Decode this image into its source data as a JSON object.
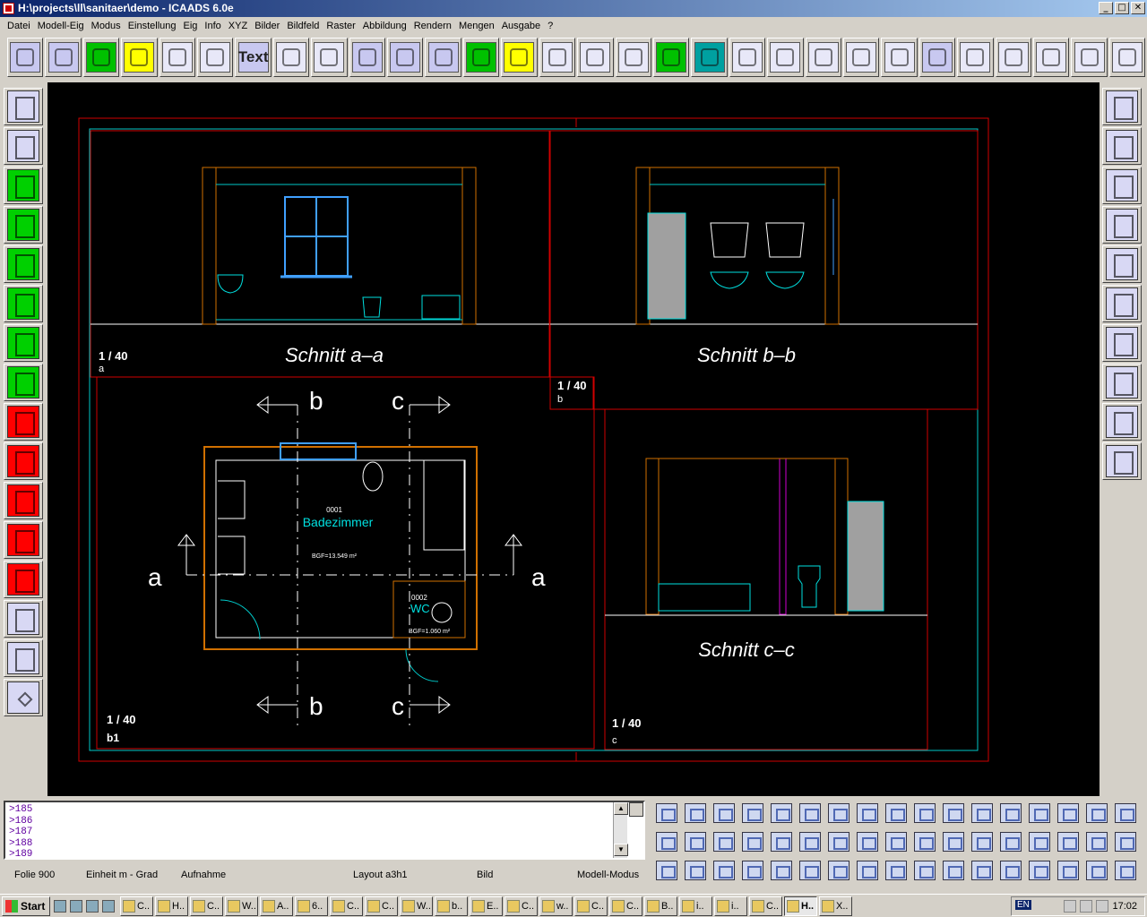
{
  "window": {
    "title": "H:\\projects\\ll\\sanitaer\\demo - ICAADS 6.0e",
    "controls": {
      "minimize": "_",
      "maximize": "□",
      "close": "✕"
    }
  },
  "menu": [
    "Datei",
    "Modell-Eig",
    "Modus",
    "Einstellung",
    "Eig",
    "Info",
    "XYZ",
    "Bilder",
    "Bildfeld",
    "Raster",
    "Abbildung",
    "Rendern",
    "Mengen",
    "Ausgabe",
    "?"
  ],
  "toolbar_top": [
    {
      "icon": "grid-points-icon",
      "style": "p"
    },
    {
      "icon": "polyline-icon",
      "style": "p"
    },
    {
      "icon": "circle-icon",
      "style": "g"
    },
    {
      "icon": "stairs-icon",
      "style": "y"
    },
    {
      "icon": "curve-icon",
      "style": "w"
    },
    {
      "icon": "mesh-icon",
      "style": "w"
    },
    {
      "icon": "text-icon",
      "style": "txt",
      "label": "Text"
    },
    {
      "icon": "dimension-icon",
      "style": "w"
    },
    {
      "icon": "hatch-icon",
      "style": "w"
    },
    {
      "icon": "symbol-library-icon",
      "style": "p"
    },
    {
      "icon": "box-3d-icon",
      "style": "p"
    },
    {
      "icon": "roof-icon",
      "style": "p"
    },
    {
      "icon": "stair-3d-icon",
      "style": "g"
    },
    {
      "icon": "pen-icon",
      "style": "y"
    },
    {
      "icon": "view-2d-icon",
      "style": "w"
    },
    {
      "icon": "frog-view-icon",
      "style": "w"
    },
    {
      "icon": "view-3d-icon",
      "style": "w"
    },
    {
      "icon": "drain-icon",
      "style": "g"
    },
    {
      "icon": "pipe-icon",
      "style": "t"
    },
    {
      "icon": "valve-symbol-icon",
      "style": "w"
    },
    {
      "icon": "gate-valve-icon",
      "style": "w"
    },
    {
      "icon": "closed-valve-icon",
      "style": "w"
    },
    {
      "icon": "pressure-gauge-icon",
      "style": "w"
    },
    {
      "icon": "elbow-icon",
      "style": "w"
    },
    {
      "icon": "wall-outlet-icon",
      "style": "p"
    },
    {
      "icon": "schematic-2d-icon",
      "style": "w"
    },
    {
      "icon": "radiator-icon",
      "style": "w"
    },
    {
      "icon": "pipe-route-icon",
      "style": "w"
    },
    {
      "icon": "duct-icon",
      "style": "w"
    },
    {
      "icon": "arrow-right-icon",
      "style": "w"
    }
  ],
  "toolbar_left": [
    {
      "icon": "draw-pencil-icon",
      "style": "p"
    },
    {
      "icon": "edit-pencil-icon",
      "style": "p"
    },
    {
      "icon": "tww-drain-icon",
      "style": "g"
    },
    {
      "icon": "drain-valve-icon",
      "style": "g"
    },
    {
      "icon": "riser-valve-icon",
      "style": "g"
    },
    {
      "icon": "triple-riser-icon",
      "style": "g"
    },
    {
      "icon": "pipe-connection-icon",
      "style": "g"
    },
    {
      "icon": "meter-icon",
      "style": "g"
    },
    {
      "icon": "tww-heater-icon",
      "style": "r"
    },
    {
      "icon": "heater-connection-icon",
      "style": "r"
    },
    {
      "icon": "heater-link-icon",
      "style": "r"
    },
    {
      "icon": "heater-riser-icon",
      "style": "r"
    },
    {
      "icon": "heater-pipe-icon",
      "style": "r"
    },
    {
      "icon": "schematic-link-icon",
      "style": "p"
    },
    {
      "icon": "schematic-node-icon",
      "style": "p"
    },
    {
      "icon": "diamond-icon",
      "style": "p dia"
    }
  ],
  "toolbar_right": [
    {
      "icon": "help-query-icon"
    },
    {
      "icon": "layer-stack-icon"
    },
    {
      "icon": "layer-number-icon"
    },
    {
      "icon": "branch-icon"
    },
    {
      "icon": "fitting-icon"
    },
    {
      "icon": "support-icon"
    },
    {
      "icon": "magnet-icon"
    },
    {
      "icon": "rotate-icon"
    },
    {
      "icon": "sphere-render-icon"
    },
    {
      "icon": "explode-icon"
    }
  ],
  "drawing": {
    "views": [
      {
        "title": "Schnitt a–a",
        "scale": "1 / 40",
        "tag": "a"
      },
      {
        "title": "Schnitt b–b",
        "scale": "1 / 40",
        "tag": "b"
      },
      {
        "title": "Schnitt c–c",
        "scale": "1 / 40",
        "tag": "c"
      },
      {
        "title": "",
        "scale": "1 / 40",
        "tag": "b1"
      }
    ],
    "room1": {
      "number": "0001",
      "name": "Badezimmer",
      "area": "BGF=13.549 m²"
    },
    "room2": {
      "number": "0002",
      "name": "WC",
      "area": "BGF=1.060 m²"
    },
    "section_marks": {
      "a": "a",
      "b": "b",
      "c": "c"
    }
  },
  "command_history": [
    ">185",
    ">186",
    ">187",
    ">188",
    ">189"
  ],
  "status": {
    "folie": "Folie  900",
    "einheit": "Einheit   m - Grad",
    "aufnahme": "Aufnahme",
    "layout": "Layout  a3h1",
    "bild": "Bild",
    "modus": "Modell-Modus"
  },
  "bottom_toolbar_rows": [
    [
      "first-icon",
      "prev-icon",
      "snap-icon",
      "lines-icon",
      "name-icon",
      "text-edit-icon",
      "color-icon",
      "dimension-chain-icon",
      "vacuum-icon",
      "globe-icon",
      "zoom-window-icon",
      "zoom-prev-icon",
      "zoom-all-icon",
      "undo-icon",
      "redo-icon",
      "brick-icon",
      "layers-color-icon"
    ],
    [
      "mirror-icon",
      "mirror2-icon",
      "help-icon",
      "align-icon",
      "name-help-icon",
      "hatch-edit-icon",
      "snap-grid-icon",
      "arc-icon",
      "zoom-in-icon",
      "zoom-out-icon",
      "pan-hand-icon",
      "delete-icon",
      "axis-icon",
      "print-icon",
      "window-tile-icon",
      "window-icon",
      "window-grid-icon"
    ],
    [
      "flip-icon",
      "flip2-icon",
      "query-icon",
      "stack-icon",
      "text-text-icon",
      "num-icon",
      "vertical-dim-icon",
      "hand-icon",
      "block-icon",
      "block2-icon",
      "block3-icon",
      "block4-icon",
      "block5-icon",
      "solid-icon",
      "grid4-icon",
      "grid4-yellow-icon",
      "grid4-multi-icon"
    ]
  ],
  "taskbar": {
    "start": "Start",
    "tasks": [
      "C..",
      "H..",
      "C..",
      "W..",
      "A..",
      "6..",
      "C..",
      "C..",
      "W..",
      "b..",
      "E..",
      "C..",
      "w..",
      "C..",
      "C..",
      "B..",
      "i..",
      "i..",
      "C..",
      "H..",
      "X.."
    ],
    "active_index": 19,
    "lang": "EN",
    "clock": "17:02"
  }
}
